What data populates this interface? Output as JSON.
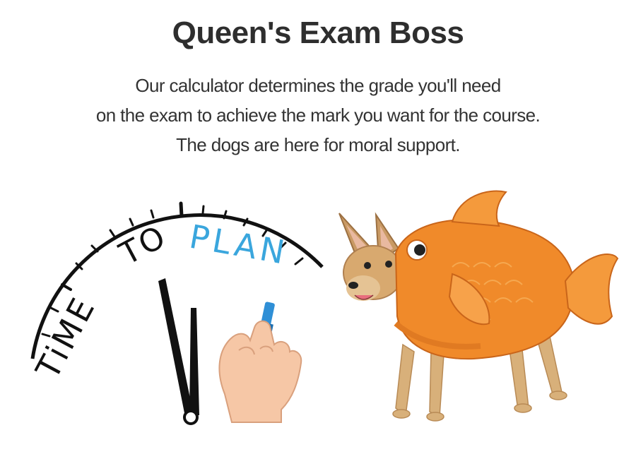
{
  "header": {
    "title": "Queen's Exam Boss"
  },
  "tagline": {
    "line1": "Our calculator determines the grade you'll need",
    "line2": "on the exam to achieve the mark you want for the course.",
    "line3": "The dogs are here for moral support."
  },
  "illustrations": {
    "clock": {
      "icon": "time-to-plan-clock",
      "text_time": "TiME",
      "text_to": "TO",
      "text_plan": "PLAN",
      "plan_color": "#3aa6dd"
    },
    "dog": {
      "icon": "dog-in-goldfish-costume",
      "costume_color": "#f08a2a"
    }
  }
}
